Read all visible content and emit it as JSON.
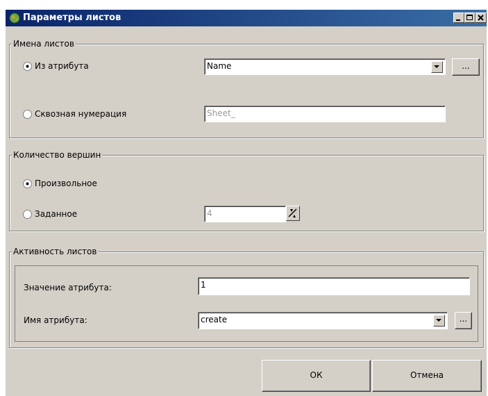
{
  "window": {
    "title": "Параметры листов",
    "icon": "app-globe-icon",
    "controls": [
      "minimize-icon",
      "maximize-icon",
      "close-icon"
    ]
  },
  "sheet_names": {
    "legend": "Имена листов",
    "from_attribute_label": "Из атрибута",
    "from_attribute_selected": true,
    "attribute_value": "Name",
    "browse_label": "...",
    "sequential_label": "Сквозная нумерация",
    "sequential_selected": false,
    "prefix_value": "Sheet_"
  },
  "vertex_count": {
    "legend": "Количество вершин",
    "arbitrary_label": "Произвольное",
    "arbitrary_selected": true,
    "specified_label": "Заданное",
    "specified_selected": false,
    "count_value": "4"
  },
  "sheet_activity": {
    "legend": "Активность листов",
    "attr_value_label": "Значение атрибута:",
    "attr_value": "1",
    "attr_name_label": "Имя атрибута:",
    "attr_name": "create",
    "browse_label": "..."
  },
  "buttons": {
    "ok": "ОК",
    "cancel": "Отмена"
  }
}
